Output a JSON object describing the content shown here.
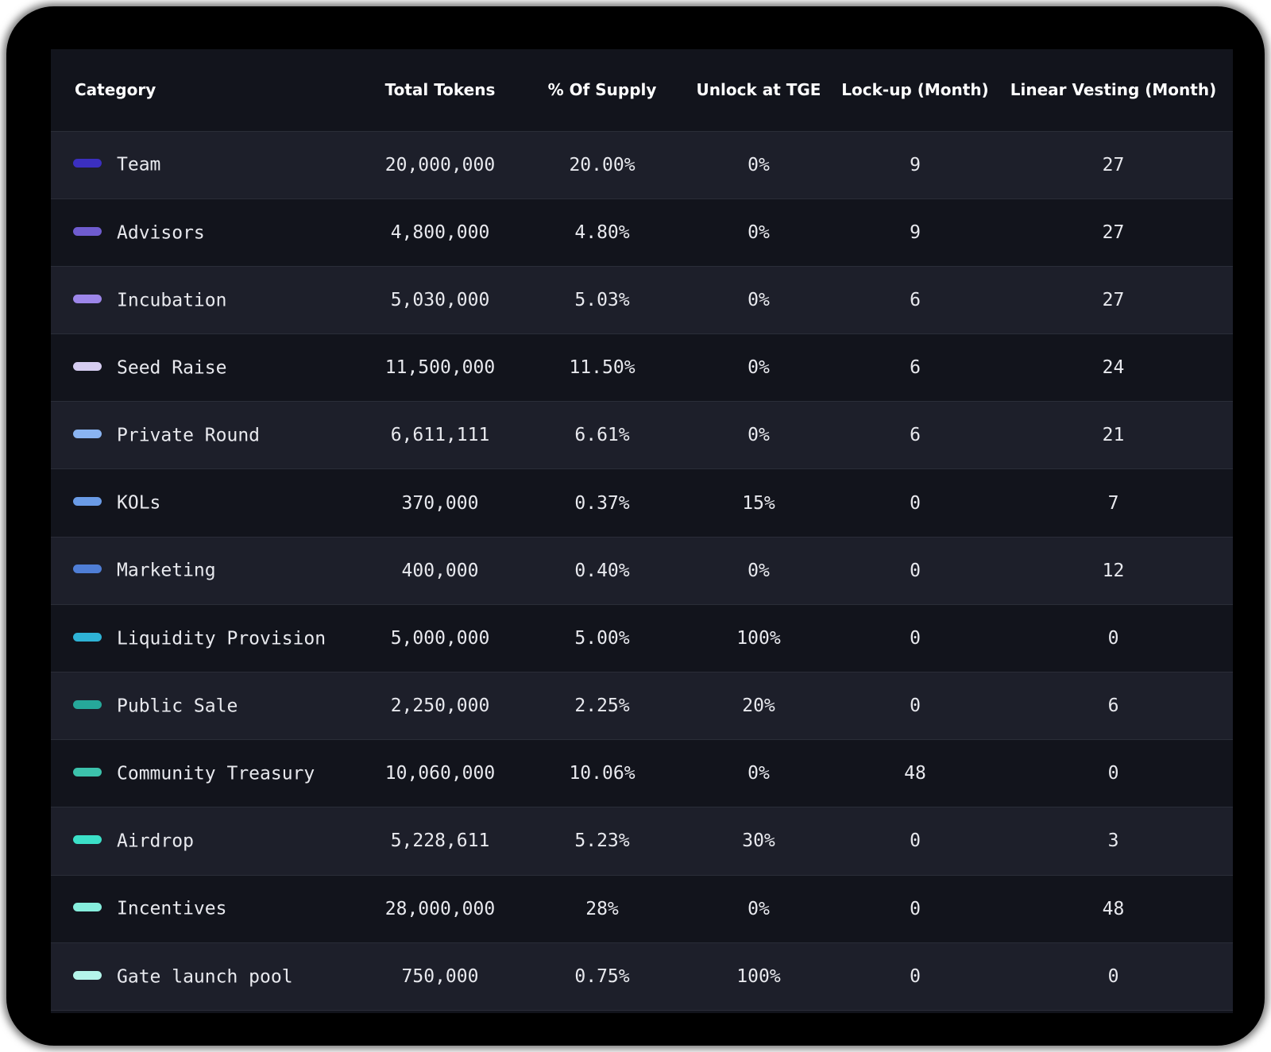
{
  "table": {
    "headers": {
      "category": "Category",
      "total_tokens": "Total Tokens",
      "pct_supply": "% Of Supply",
      "unlock_tge": "Unlock at TGE",
      "lockup": "Lock-up (Month)",
      "vesting": "Linear Vesting (Month)"
    },
    "rows": [
      {
        "category": "Team",
        "color": "#3b2fbf",
        "total_tokens": "20,000,000",
        "pct_supply": "20.00%",
        "unlock_tge": "0%",
        "lockup": "9",
        "vesting": "27"
      },
      {
        "category": "Advisors",
        "color": "#6f5ccf",
        "total_tokens": "4,800,000",
        "pct_supply": "4.80%",
        "unlock_tge": "0%",
        "lockup": "9",
        "vesting": "27"
      },
      {
        "category": "Incubation",
        "color": "#9d86ea",
        "total_tokens": "5,030,000",
        "pct_supply": "5.03%",
        "unlock_tge": "0%",
        "lockup": "6",
        "vesting": "27"
      },
      {
        "category": "Seed Raise",
        "color": "#d6cdf1",
        "total_tokens": "11,500,000",
        "pct_supply": "11.50%",
        "unlock_tge": "0%",
        "lockup": "6",
        "vesting": "24"
      },
      {
        "category": "Private Round",
        "color": "#8ab4f2",
        "total_tokens": "6,611,111",
        "pct_supply": "6.61%",
        "unlock_tge": "0%",
        "lockup": "6",
        "vesting": "21"
      },
      {
        "category": "KOLs",
        "color": "#6a9be6",
        "total_tokens": "370,000",
        "pct_supply": "0.37%",
        "unlock_tge": "15%",
        "lockup": "0",
        "vesting": "7"
      },
      {
        "category": "Marketing",
        "color": "#4f7ed6",
        "total_tokens": "400,000",
        "pct_supply": "0.40%",
        "unlock_tge": "0%",
        "lockup": "0",
        "vesting": "12"
      },
      {
        "category": "Liquidity Provision",
        "color": "#2eb3d6",
        "total_tokens": "5,000,000",
        "pct_supply": "5.00%",
        "unlock_tge": "100%",
        "lockup": "0",
        "vesting": "0"
      },
      {
        "category": "Public Sale",
        "color": "#26a89a",
        "total_tokens": "2,250,000",
        "pct_supply": "2.25%",
        "unlock_tge": "20%",
        "lockup": "0",
        "vesting": "6"
      },
      {
        "category": "Community Treasury",
        "color": "#3cc2ac",
        "total_tokens": "10,060,000",
        "pct_supply": "10.06%",
        "unlock_tge": "0%",
        "lockup": "48",
        "vesting": "0"
      },
      {
        "category": "Airdrop",
        "color": "#3be0c8",
        "total_tokens": "5,228,611",
        "pct_supply": "5.23%",
        "unlock_tge": "30%",
        "lockup": "0",
        "vesting": "3"
      },
      {
        "category": "Incentives",
        "color": "#86eedd",
        "total_tokens": "28,000,000",
        "pct_supply": "28%",
        "unlock_tge": "0%",
        "lockup": "0",
        "vesting": "48"
      },
      {
        "category": "Gate launch pool",
        "color": "#b4f5ea",
        "total_tokens": "750,000",
        "pct_supply": "0.75%",
        "unlock_tge": "100%",
        "lockup": "0",
        "vesting": "0"
      }
    ]
  }
}
